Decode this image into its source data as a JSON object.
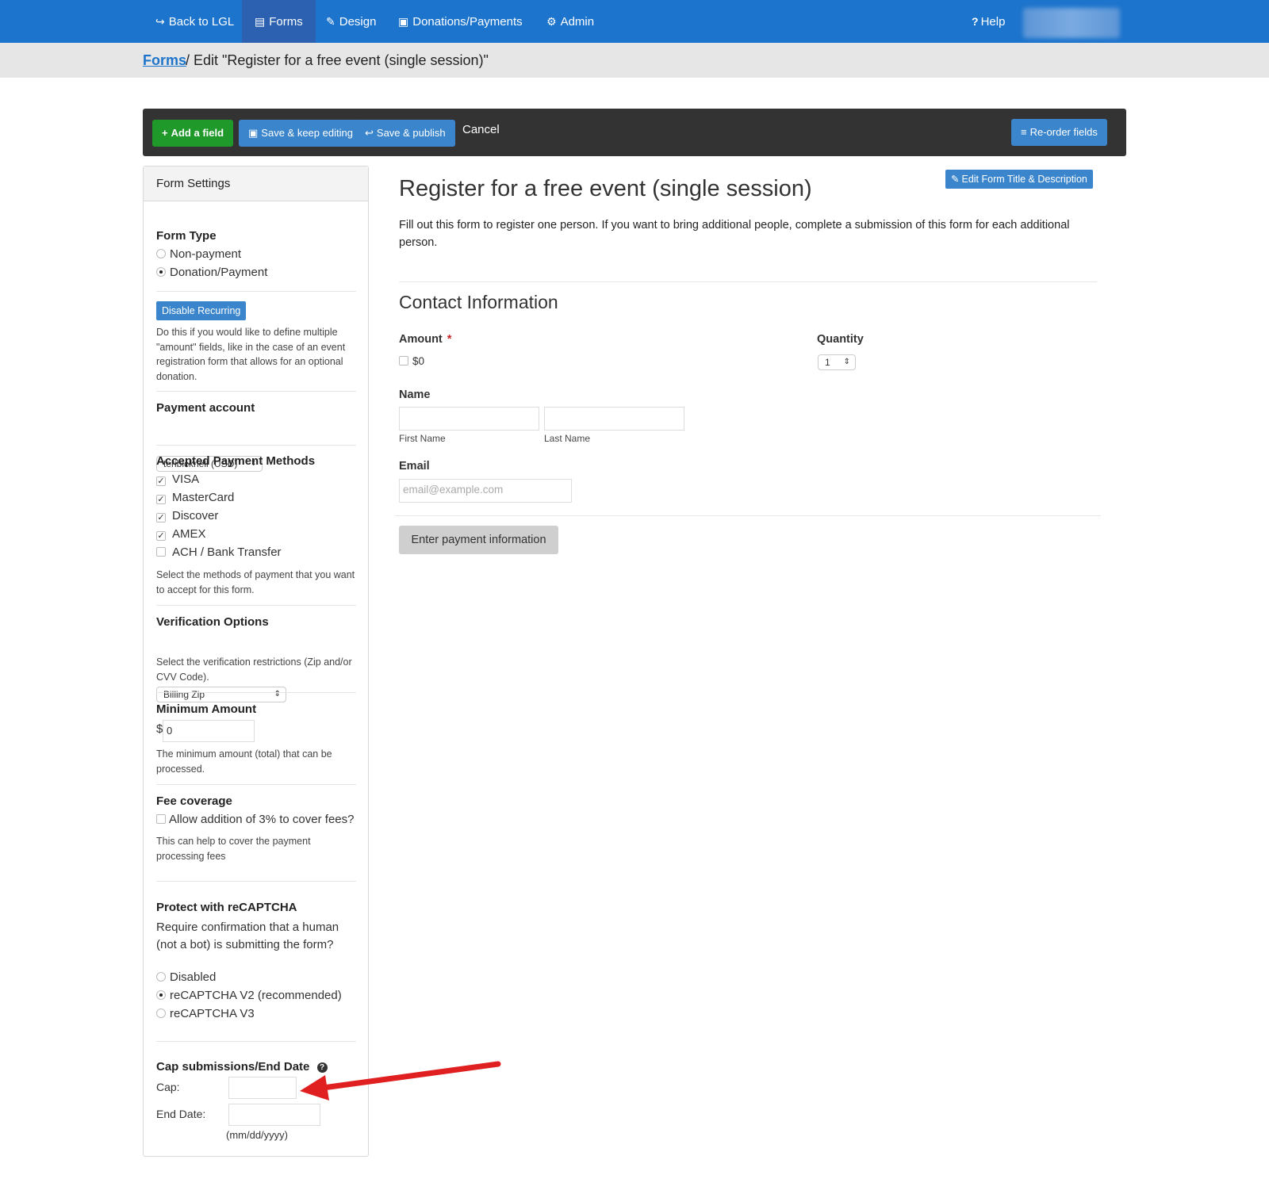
{
  "nav": {
    "items": [
      {
        "icon": "share-icon",
        "glyph": "↪",
        "label": "Back to LGL",
        "active": false
      },
      {
        "icon": "list-icon",
        "glyph": "▤",
        "label": "Forms",
        "active": true
      },
      {
        "icon": "pencil-icon",
        "glyph": "✎",
        "label": "Design",
        "active": false
      },
      {
        "icon": "money-icon",
        "glyph": "▣",
        "label": "Donations/Payments",
        "active": false
      },
      {
        "icon": "gear-icon",
        "glyph": "⚙",
        "label": "Admin",
        "active": false
      }
    ],
    "help_label": "Help",
    "help_glyph": "?"
  },
  "breadcrumb": {
    "link": "Forms",
    "rest": "/ Edit \"Register for a free event (single session)\""
  },
  "toolbar": {
    "add_field": "Add a field",
    "save_keep": "Save & keep editing",
    "save_publish": "Save & publish",
    "cancel": "Cancel",
    "reorder": "Re-order fields"
  },
  "sidebar": {
    "title": "Form Settings",
    "form_type": {
      "label": "Form Type",
      "options": [
        "Non-payment",
        "Donation/Payment"
      ],
      "selected": "Donation/Payment"
    },
    "recurring": {
      "button": "Disable Recurring",
      "help": "Do this if you would like to define multiple \"amount\" fields, like in the case of an event registration form that allows for an optional donation."
    },
    "payment_account": {
      "label": "Payment account",
      "value": "teribicknell (USD)"
    },
    "methods": {
      "label": "Accepted Payment Methods",
      "items": [
        {
          "label": "VISA",
          "checked": true
        },
        {
          "label": "MasterCard",
          "checked": true
        },
        {
          "label": "Discover",
          "checked": true
        },
        {
          "label": "AMEX",
          "checked": true
        },
        {
          "label": "ACH / Bank Transfer",
          "checked": false
        }
      ],
      "help": "Select the methods of payment that you want to accept for this form."
    },
    "verification": {
      "label": "Verification Options",
      "value": "Billing Zip",
      "help": "Select the verification restrictions (Zip and/or CVV Code)."
    },
    "minimum": {
      "label": "Minimum Amount",
      "currency": "$",
      "value": "0",
      "help": "The minimum amount (total) that can be processed."
    },
    "fee": {
      "label": "Fee coverage",
      "option": "Allow addition of 3% to cover fees?",
      "help": "This can help to cover the payment processing fees"
    },
    "recaptcha": {
      "label": "Protect with reCAPTCHA",
      "desc": "Require confirmation that a human (not a bot) is submitting the form?",
      "options": [
        "Disabled",
        "reCAPTCHA V2 (recommended)",
        "reCAPTCHA V3"
      ],
      "selected": "reCAPTCHA V2 (recommended)"
    },
    "cap": {
      "label": "Cap submissions/End Date",
      "cap_label": "Cap:",
      "end_label": "End Date:",
      "date_hint": "(mm/dd/yyyy)"
    }
  },
  "main": {
    "edit_title_button": "Edit Form Title & Description",
    "title": "Register for a free event (single session)",
    "description": "Fill out this form to register one person. If you want to bring additional people, complete a submission of this form for each additional person.",
    "section": "Contact Information",
    "amount_label": "Amount",
    "required_mark": "*",
    "amount_option": "$0",
    "quantity_label": "Quantity",
    "quantity_value": "1",
    "name_label": "Name",
    "first_name": "First Name",
    "last_name": "Last Name",
    "email_label": "Email",
    "email_placeholder": "email@example.com",
    "pay_button": "Enter payment information"
  },
  "colors": {
    "nav_bg": "#1c74cc",
    "toolbar_bg": "#333333",
    "green_button": "#1f9a2a",
    "blue_button": "#3a85cc",
    "annotation_arrow": "#e02020"
  }
}
